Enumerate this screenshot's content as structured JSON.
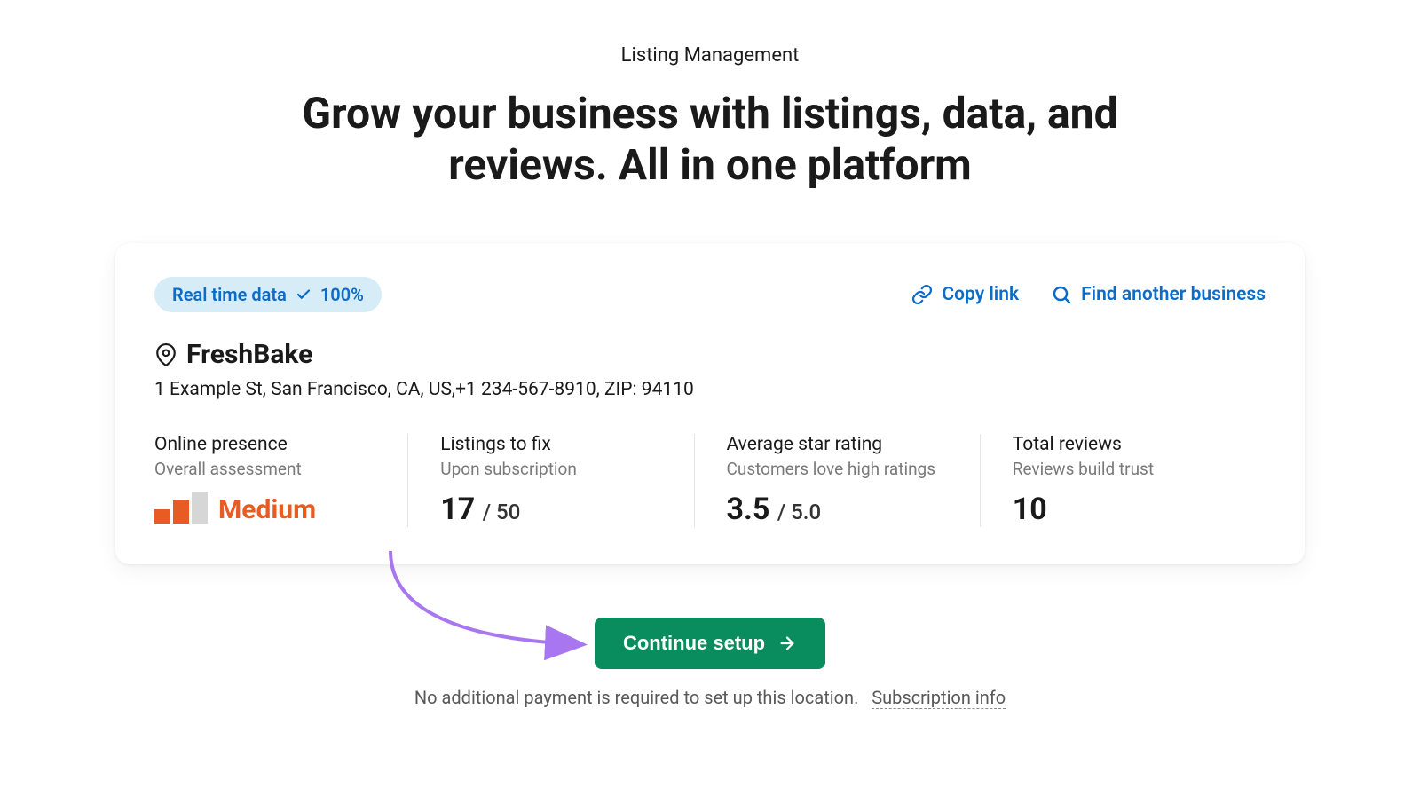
{
  "header": {
    "eyebrow": "Listing Management",
    "headline": "Grow your business with listings, data, and reviews. All in one platform"
  },
  "card": {
    "badge": {
      "label": "Real time data",
      "value": "100%"
    },
    "links": {
      "copy": "Copy link",
      "find": "Find another business"
    },
    "business": {
      "name": "FreshBake",
      "address": "1 Example St, San Francisco, CA, US,+1 234-567-8910, ZIP: 94110"
    },
    "metrics": {
      "presence": {
        "title": "Online presence",
        "subtitle": "Overall assessment",
        "level": "Medium"
      },
      "listings": {
        "title": "Listings to fix",
        "subtitle": "Upon subscription",
        "value": "17",
        "total": "/ 50"
      },
      "rating": {
        "title": "Average star rating",
        "subtitle": "Customers love high ratings",
        "value": "3.5",
        "total": "/ 5.0"
      },
      "reviews": {
        "title": "Total reviews",
        "subtitle": "Reviews build trust",
        "value": "10"
      }
    }
  },
  "cta": {
    "button": "Continue setup",
    "footnote": "No additional payment is required to set up this location.",
    "subscription_link": "Subscription info"
  }
}
